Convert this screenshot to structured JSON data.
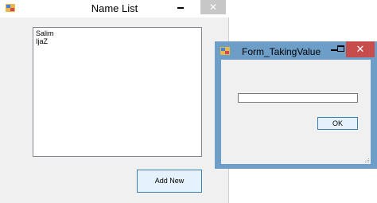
{
  "main_window": {
    "title": "Name List",
    "close_glyph": "✕",
    "list_items": [
      "Salim",
      "IjaZ"
    ],
    "add_button_label": "Add New"
  },
  "dialog": {
    "title": "Form_TakingValue",
    "close_glyph": "✕",
    "input_value": "",
    "ok_label": "OK"
  },
  "colors": {
    "dialog_frame": "#6d9ec8",
    "close_hover": "#c74c4c"
  }
}
